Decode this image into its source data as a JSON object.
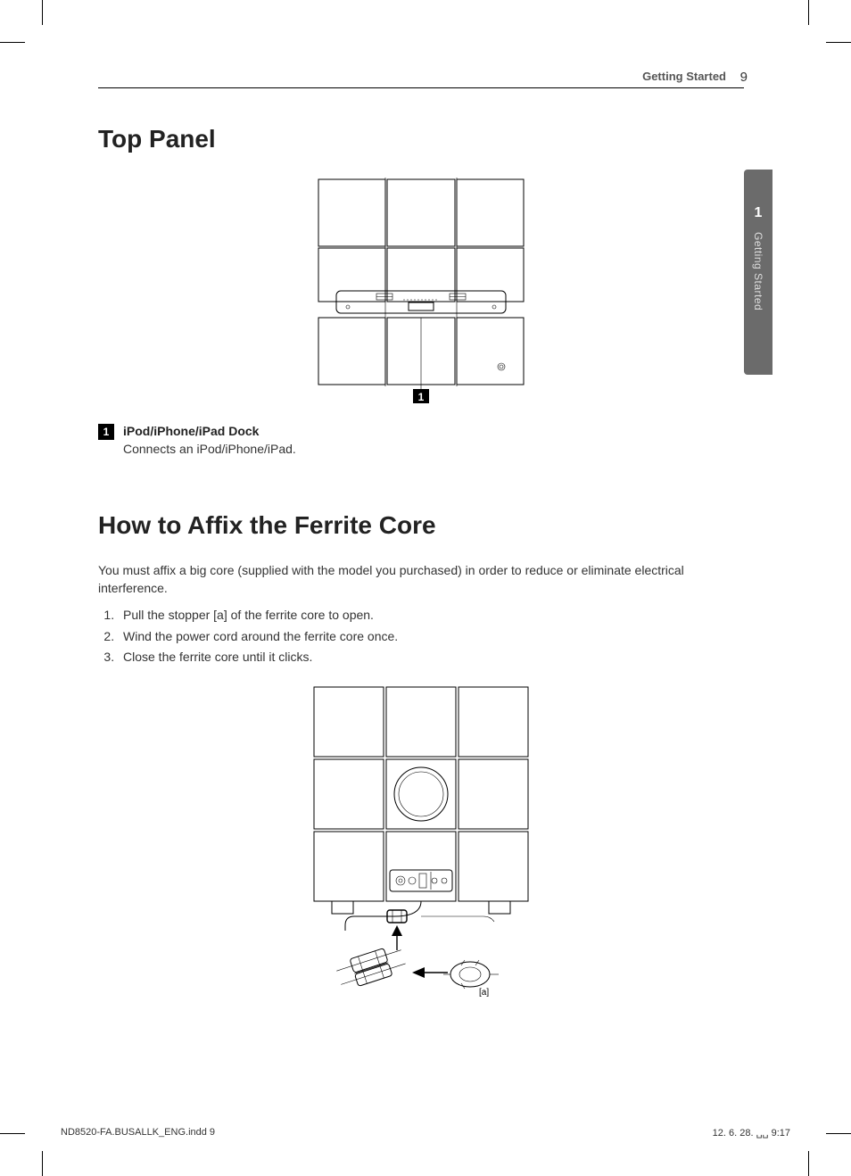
{
  "header": {
    "section": "Getting Started",
    "page": "9"
  },
  "side_tab": {
    "number": "1",
    "label": "Getting Started"
  },
  "sections": {
    "top_panel": {
      "title": "Top Panel",
      "callout": {
        "num": "1",
        "title": "iPod/iPhone/iPad Dock",
        "desc": "Connects an iPod/iPhone/iPad."
      },
      "figure_label": "1"
    },
    "ferrite": {
      "title": "How to Affix the Ferrite Core",
      "intro": "You must affix a big core (supplied with the model you purchased) in order to reduce or eliminate electrical interference.",
      "steps": [
        "Pull the stopper [a] of the ferrite core to open.",
        "Wind the power cord around the ferrite core once.",
        "Close the ferrite core until it clicks."
      ],
      "annotation": "[a]"
    }
  },
  "footer": {
    "filename": "ND8520-FA.BUSALLK_ENG.indd   9",
    "timestamp": "12. 6. 28.   ␣␣ 9:17"
  }
}
